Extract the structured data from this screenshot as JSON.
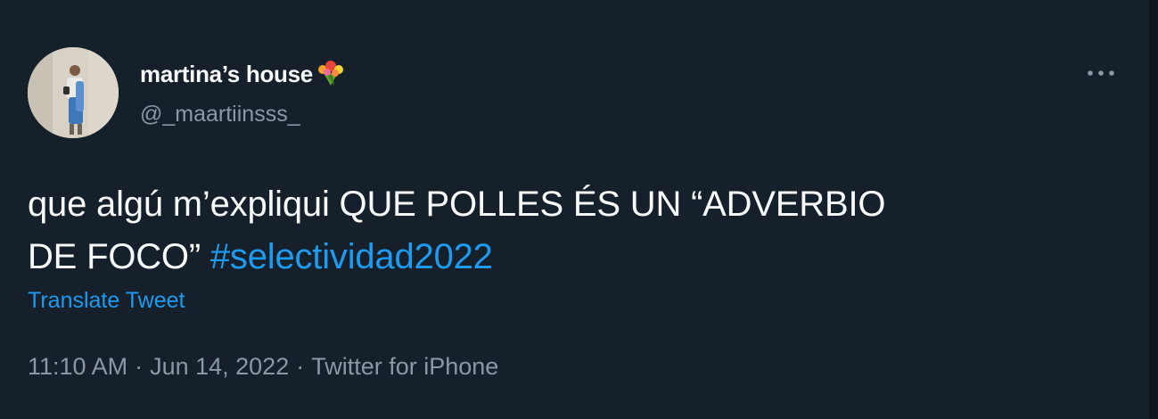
{
  "tweet": {
    "author": {
      "display_name": "martina’s house",
      "emoji": "bouquet-icon",
      "handle": "@_maartiinsss_"
    },
    "text": {
      "line1": "que algú m’expliqui QUE POLLES ÉS UN “ADVERBIO",
      "line2_prefix": "DE FOCO”",
      "hashtag": "#selectividad2022"
    },
    "translate_label": "Translate Tweet",
    "meta": {
      "time": "11:10 AM",
      "separator": "·",
      "date": "Jun 14, 2022",
      "source": "Twitter for iPhone"
    },
    "icons": {
      "more": "more-icon"
    }
  },
  "colors": {
    "background": "#15202b",
    "text": "#f7f9f9",
    "secondary": "#8b98a5",
    "link": "#1d9bf0"
  }
}
